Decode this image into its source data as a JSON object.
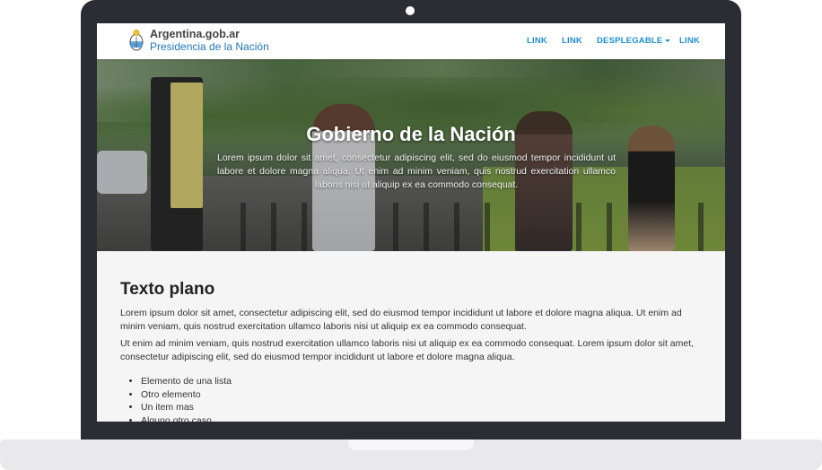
{
  "brand": {
    "line1": "Argentina.gob.ar",
    "line2": "Presidencia de la Nación"
  },
  "nav": {
    "items": [
      {
        "label": "LINK"
      },
      {
        "label": "LINK"
      },
      {
        "label": "DESPLEGABLE"
      },
      {
        "label": "LINK"
      }
    ]
  },
  "hero": {
    "title": "Gobierno de la Nación",
    "lead": "Lorem ipsum dolor sit amet, consectetur adipiscing elit, sed do eiusmod tempor incididunt ut labore et dolore magna aliqua. Ut enim ad minim veniam, quis nostrud exercitation ullamco laboris nisi ut aliquip ex ea commodo consequat."
  },
  "main": {
    "title": "Texto plano",
    "paragraphs": [
      "Lorem ipsum dolor sit amet, consectetur adipiscing elit, sed do eiusmod tempor incididunt ut labore et dolore magna aliqua. Ut enim ad minim veniam, quis nostrud exercitation ullamco laboris nisi ut aliquip ex ea commodo consequat.",
      "Ut enim ad minim veniam, quis nostrud exercitation ullamco laboris nisi ut aliquip ex ea commodo consequat. Lorem ipsum dolor sit amet, consectetur adipiscing elit, sed do eiusmod tempor incididunt ut labore et dolore magna aliqua."
    ],
    "list": [
      "Elemento de una lista",
      "Otro elemento",
      "Un item mas",
      "Alguno otro caso"
    ]
  },
  "colors": {
    "link": "#1f8fd0",
    "brand_blue": "#1f77b7",
    "frame": "#2c2c34"
  },
  "icons": {
    "logo": "argentina-coat-of-arms-icon",
    "dropdown": "caret-down-icon"
  }
}
